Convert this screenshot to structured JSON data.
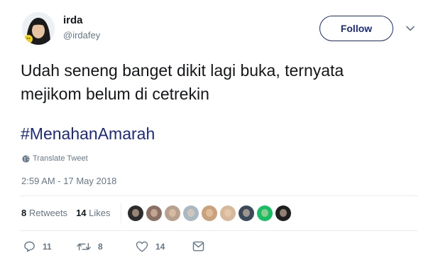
{
  "user": {
    "name": "irda",
    "handle": "@irdafey"
  },
  "follow_label": "Follow",
  "tweet": {
    "text": "Udah seneng banget dikit lagi buka, ternyata\nmejikom belum di cetrekin",
    "hashtag": "#MenahanAmarah",
    "translate_label": "Translate Tweet",
    "timestamp": "2:59 AM - 17 May 2018"
  },
  "stats": {
    "retweets_count": "8",
    "retweets_label": "Retweets",
    "likes_count": "14",
    "likes_label": "Likes"
  },
  "liker_avatars": [
    "#2c2c2c",
    "#8a6f64",
    "#b7a08c",
    "#aab8c2",
    "#c9a27c",
    "#d6b99a",
    "#3b4a5a",
    "#17bf63",
    "#1f1f1f"
  ],
  "actions": {
    "reply_count": "11",
    "retweet_count": "8",
    "like_count": "14"
  },
  "colors": {
    "accent": "#1d2b7e",
    "muted": "#657786",
    "text": "#14171a",
    "divider": "#e6ecf0"
  }
}
